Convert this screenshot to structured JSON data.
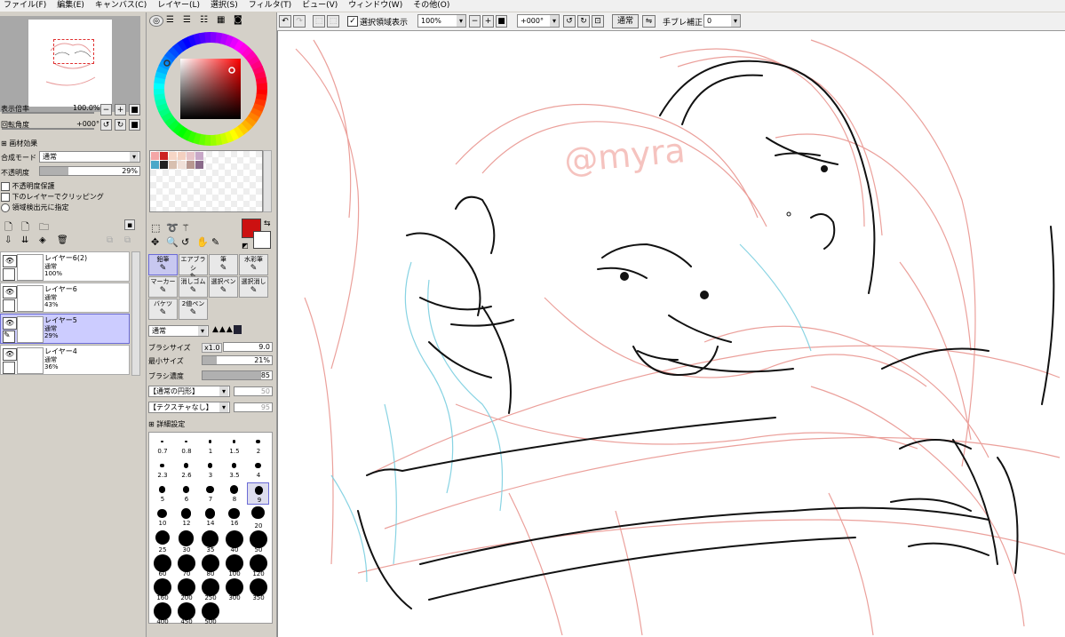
{
  "menu": [
    "ファイル(F)",
    "編集(E)",
    "キャンバス(C)",
    "レイヤー(L)",
    "選択(S)",
    "フィルタ(T)",
    "ビュー(V)",
    "ウィンドウ(W)",
    "その他(O)"
  ],
  "navigator": {
    "zoom_label": "表示倍率",
    "zoom_value": "100.0%",
    "rotate_label": "回転角度",
    "rotate_value": "+000°"
  },
  "paper_effect": {
    "label": "画材効果"
  },
  "layer_props": {
    "blend_label": "合成モード",
    "blend_value": "通常",
    "opacity_label": "不透明度",
    "opacity_value": "29%",
    "opacity_level": 0.29,
    "preserve_opacity": "不透明度保護",
    "clip_below": "下のレイヤーでクリッピング",
    "selection_source": "領域検出元に指定"
  },
  "layers": [
    {
      "name": "レイヤー6(2)",
      "mode": "通常",
      "opacity": "100%",
      "selected": false
    },
    {
      "name": "レイヤー6",
      "mode": "通常",
      "opacity": "43%",
      "selected": false
    },
    {
      "name": "レイヤー5",
      "mode": "通常",
      "opacity": "29%",
      "selected": true
    },
    {
      "name": "レイヤー4",
      "mode": "通常",
      "opacity": "36%",
      "selected": false
    }
  ],
  "colors": {
    "primary": "#cc1111",
    "secondary": "#ffffff",
    "swatches": [
      "#f4a6a6",
      "#cc2222",
      "#f6d6c6",
      "#f3d0c0",
      "#e7c4c8",
      "#c8a8c8",
      "#4aa8c8",
      "#222222",
      "#d8c0b0",
      "#f0e0d8",
      "#b89890",
      "#8a6a8a"
    ]
  },
  "tools": [
    {
      "label": "鉛筆",
      "selected": true
    },
    {
      "label": "エアブラシ",
      "selected": false
    },
    {
      "label": "筆",
      "selected": false
    },
    {
      "label": "水彩筆",
      "selected": false
    },
    {
      "label": "マーカー",
      "selected": false
    },
    {
      "label": "消しゴム",
      "selected": false
    },
    {
      "label": "選択ペン",
      "selected": false
    },
    {
      "label": "選択消し",
      "selected": false
    },
    {
      "label": "バケツ",
      "selected": false
    },
    {
      "label": "2値ペン",
      "selected": false
    }
  ],
  "brush": {
    "mode": "通常",
    "size_label": "ブラシサイズ",
    "size_mult": "x1.0",
    "size_value": "9.0",
    "min_size_label": "最小サイズ",
    "min_size_value": "21%",
    "density_label": "ブラシ濃度",
    "density_value": "85",
    "shape": "【通常の円形】",
    "shape_value": "50",
    "texture": "【テクスチャなし】",
    "texture_value": "95",
    "detail_label": "詳細設定"
  },
  "brush_sizes": [
    "0.7",
    "0.8",
    "1",
    "1.5",
    "2",
    "2.3",
    "2.6",
    "3",
    "3.5",
    "4",
    "5",
    "6",
    "7",
    "8",
    "9",
    "10",
    "12",
    "14",
    "16",
    "20",
    "25",
    "30",
    "35",
    "40",
    "50",
    "60",
    "70",
    "80",
    "100",
    "120",
    "160",
    "200",
    "250",
    "300",
    "350",
    "400",
    "450",
    "500"
  ],
  "selected_brush_size": "9",
  "toolbar": {
    "show_selection": "選択領域表示",
    "zoom": "100%",
    "rotation": "+000°",
    "blend": "通常",
    "stabilizer_label": "手ブレ補正",
    "stabilizer_value": "0"
  },
  "watermark": "@myra"
}
